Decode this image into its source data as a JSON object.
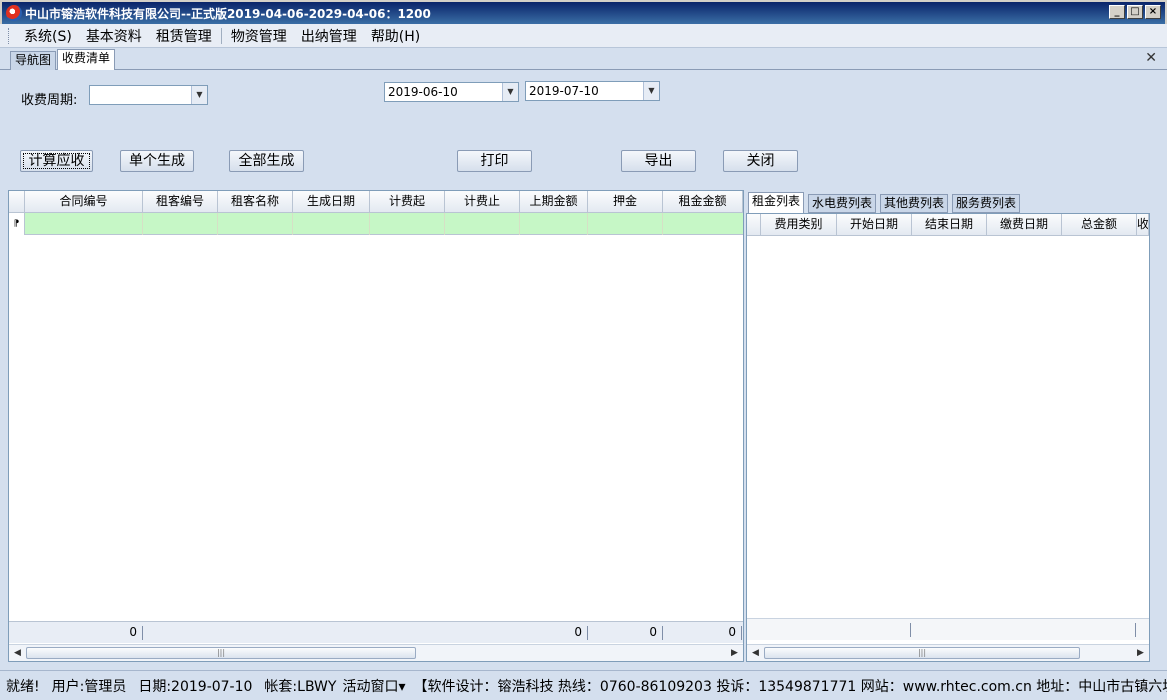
{
  "window": {
    "title": "中山市镕浩软件科技有限公司--正式版2019-04-06-2029-04-06：1200"
  },
  "menu": [
    {
      "label": "系统(S)"
    },
    {
      "label": "基本资料"
    },
    {
      "label": "租赁管理"
    },
    {
      "label": "物资管理"
    },
    {
      "label": "出纳管理"
    },
    {
      "label": "帮助(H)"
    }
  ],
  "doc_tabs": [
    {
      "label": "导航图",
      "active": false
    },
    {
      "label": "收费清单",
      "active": true
    }
  ],
  "filter": {
    "period_label": "收费周期:",
    "period_value": "",
    "start_date": "2019-06-10",
    "end_date": "2019-07-10"
  },
  "buttons": {
    "calc": "计算应收",
    "single": "单个生成",
    "all": "全部生成",
    "print": "打印",
    "export": "导出",
    "close": "关闭"
  },
  "left_grid": {
    "columns": [
      "合同编号",
      "租客编号",
      "租客名称",
      "生成日期",
      "计费起",
      "计费止",
      "上期金额",
      "押金",
      "租金金额"
    ],
    "footer": [
      "0",
      "0",
      "0",
      "0"
    ]
  },
  "right_tabs": [
    "租金列表",
    "水电费列表",
    "其他费列表",
    "服务费列表"
  ],
  "right_grid": {
    "columns": [
      "费用类别",
      "开始日期",
      "结束日期",
      "缴费日期",
      "总金额",
      "收"
    ]
  },
  "status": {
    "ready": "就绪!",
    "user": "用户:管理员",
    "date": "日期:2019-07-10",
    "account": "帐套:LBWY",
    "active_window": "活动窗口▾",
    "info": "【软件设计：镕浩科技 热线：0760-86109203 投诉：13549871771 网站：www.rhtec.com.cn 地址：中山市古镇六坊"
  },
  "colors": {
    "titlebar": "#0a246a",
    "background": "#d4dfee",
    "new_row": "#c6f7c6"
  }
}
